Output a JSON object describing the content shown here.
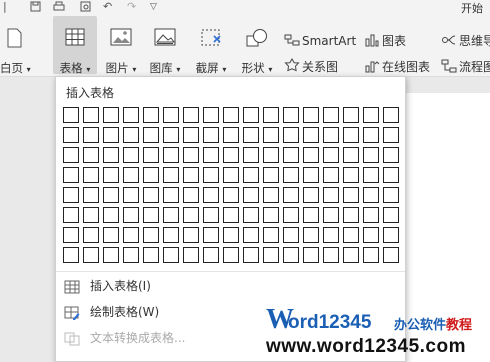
{
  "quick_access": {
    "start_tab_label": "开始"
  },
  "ribbon": {
    "blank_page_label": "白页",
    "table_label": "表格",
    "picture_label": "图片",
    "library_label": "图库",
    "screenshot_label": "截屏",
    "shape_label": "形状",
    "smartart_label": "SmartArt",
    "chart_label": "图表",
    "mindmap_label": "思维导",
    "relation_label": "关系图",
    "online_chart_label": "在线图表",
    "flowchart_label": "流程图"
  },
  "dropdown": {
    "title": "插入表格",
    "grid_rows": 8,
    "grid_cols": 17,
    "menu_items": [
      {
        "label": "插入表格(I)",
        "icon": "table-icon",
        "enabled": true
      },
      {
        "label": "绘制表格(W)",
        "icon": "pencil-table-icon",
        "enabled": true
      },
      {
        "label": "文本转换成表格...",
        "icon": "convert-icon",
        "enabled": false
      }
    ]
  },
  "watermark": {
    "brand_prefix": "W",
    "brand_rest": "ord12345",
    "tagline": "办公软件教程",
    "url": "www.word12345.com",
    "colors": {
      "blue": "#1a5fb4",
      "red": "#d01c1c"
    }
  }
}
